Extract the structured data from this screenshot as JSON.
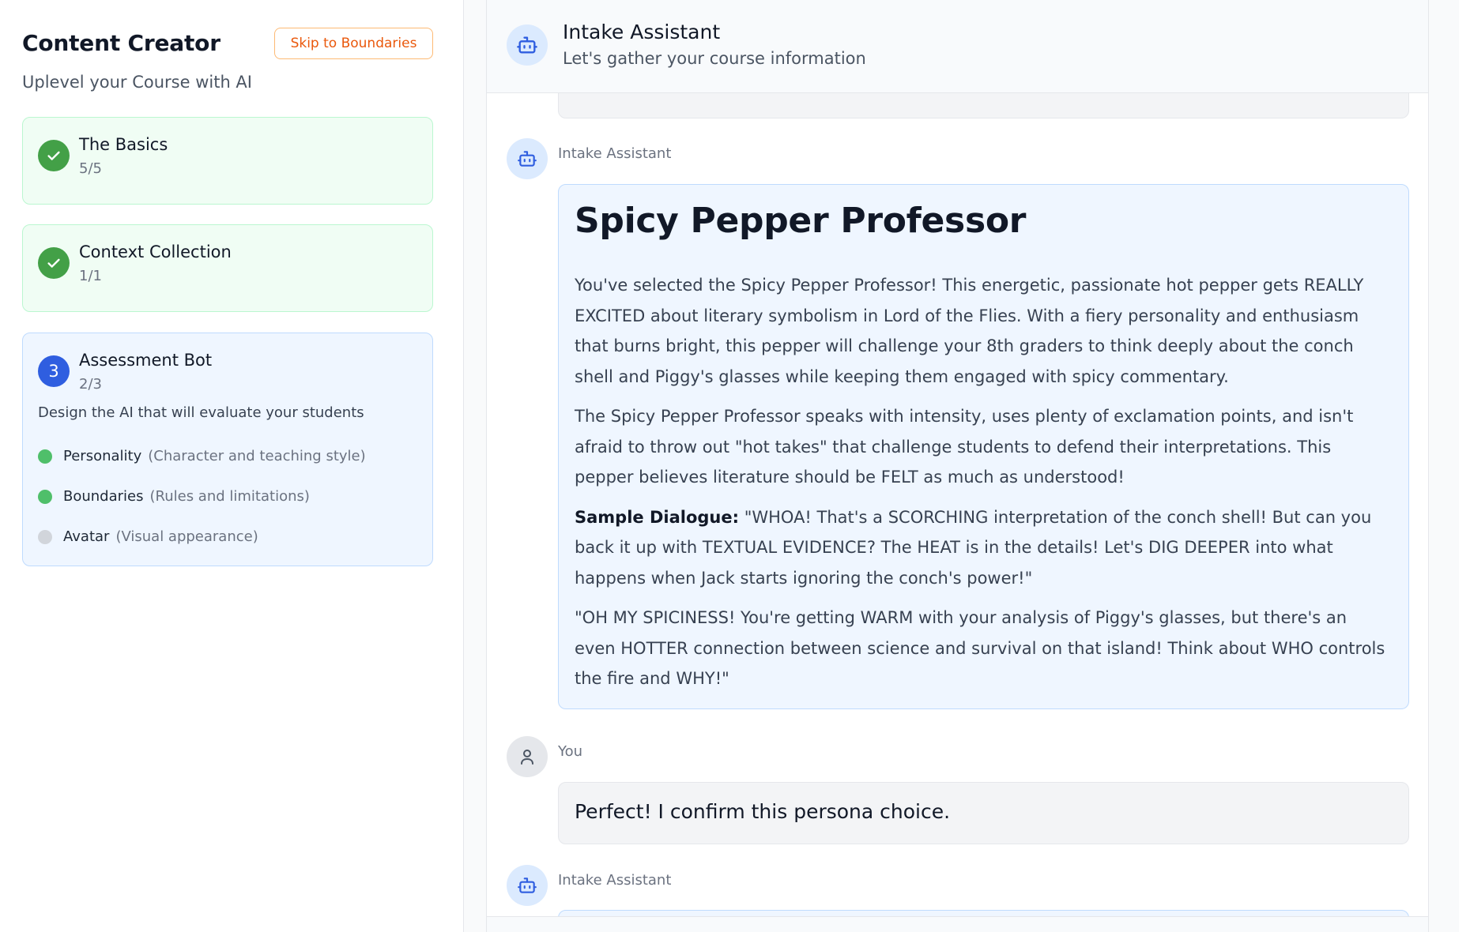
{
  "sidebar": {
    "title": "Content Creator",
    "subtitle": "Uplevel your Course with AI",
    "skip_button": "Skip to Boundaries",
    "steps": [
      {
        "title": "The Basics",
        "count": "5/5",
        "status": "complete"
      },
      {
        "title": "Context Collection",
        "count": "1/1",
        "status": "complete"
      },
      {
        "number": "3",
        "title": "Assessment Bot",
        "count": "2/3",
        "status": "active",
        "description": "Design the AI that will evaluate your students",
        "items": [
          {
            "label": "Personality",
            "hint": "(Character and teaching style)",
            "done": true
          },
          {
            "label": "Boundaries",
            "hint": "(Rules and limitations)",
            "done": true
          },
          {
            "label": "Avatar",
            "hint": "(Visual appearance)",
            "done": false
          }
        ]
      }
    ]
  },
  "chat": {
    "header": {
      "title": "Intake Assistant",
      "subtitle": "Let's gather your course information"
    },
    "messages": [
      {
        "author": "Intake Assistant",
        "heading": "Spicy Pepper Professor",
        "paragraphs": [
          "You've selected the Spicy Pepper Professor! This energetic, passionate hot pepper gets REALLY EXCITED about literary symbolism in Lord of the Flies. With a fiery personality and enthusiasm that burns bright, this pepper will challenge your 8th graders to think deeply about the conch shell and Piggy's glasses while keeping them engaged with spicy commentary.",
          "The Spicy Pepper Professor speaks with intensity, uses plenty of exclamation points, and isn't afraid to throw out \"hot takes\" that challenge students to defend their interpretations. This pepper believes literature should be FELT as much as understood!"
        ],
        "sample_label": "Sample Dialogue:",
        "sample_text": " \"WHOA! That's a SCORCHING interpretation of the conch shell! But can you back it up with TEXTUAL EVIDENCE? The HEAT is in the details! Let's DIG DEEPER into what happens when Jack starts ignoring the conch's power!\"",
        "closing": "\"OH MY SPICINESS! You're getting WARM with your analysis of Piggy's glasses, but there's an even HOTTER connection between science and survival on that island! Think about WHO controls the fire and WHY!\""
      },
      {
        "author": "You",
        "text": "Perfect! I confirm this persona choice."
      },
      {
        "author": "Intake Assistant"
      }
    ]
  },
  "icons": {
    "bot": "robot-icon",
    "user": "user-icon",
    "check": "check-icon"
  },
  "colors": {
    "accent_blue": "#2f5ee0",
    "success_green": "#43a047",
    "skip_orange": "#ea580c"
  }
}
